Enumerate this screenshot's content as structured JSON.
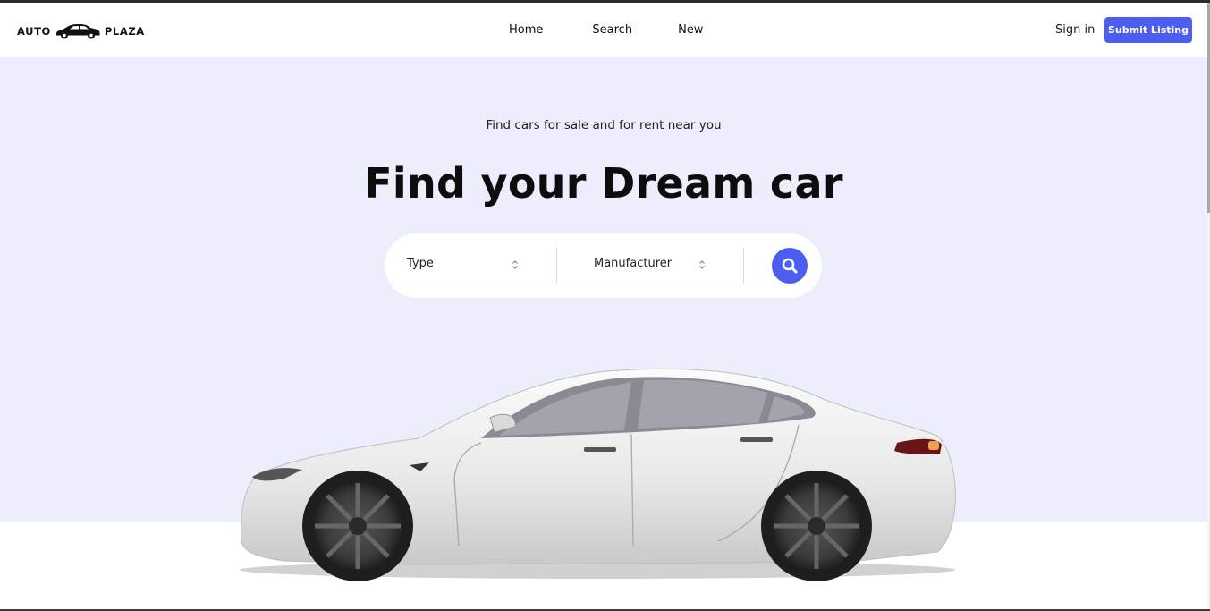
{
  "brand": {
    "left": "AUTO",
    "right": "PLAZA",
    "icon": "car-logo-icon"
  },
  "nav": {
    "home": "Home",
    "search": "Search",
    "new": "New"
  },
  "auth": {
    "signin": "Sign in",
    "submit": "Submit Listing"
  },
  "hero": {
    "subtitle": "Find cars for sale and for rent near you",
    "title": "Find your Dream car"
  },
  "search": {
    "type_value": "Type",
    "manufacturer_value": "Manufacturer",
    "button_icon": "search-icon"
  },
  "colors": {
    "accent": "#4c5ef0",
    "hero_bg": "#eceefc",
    "text": "#111111"
  }
}
